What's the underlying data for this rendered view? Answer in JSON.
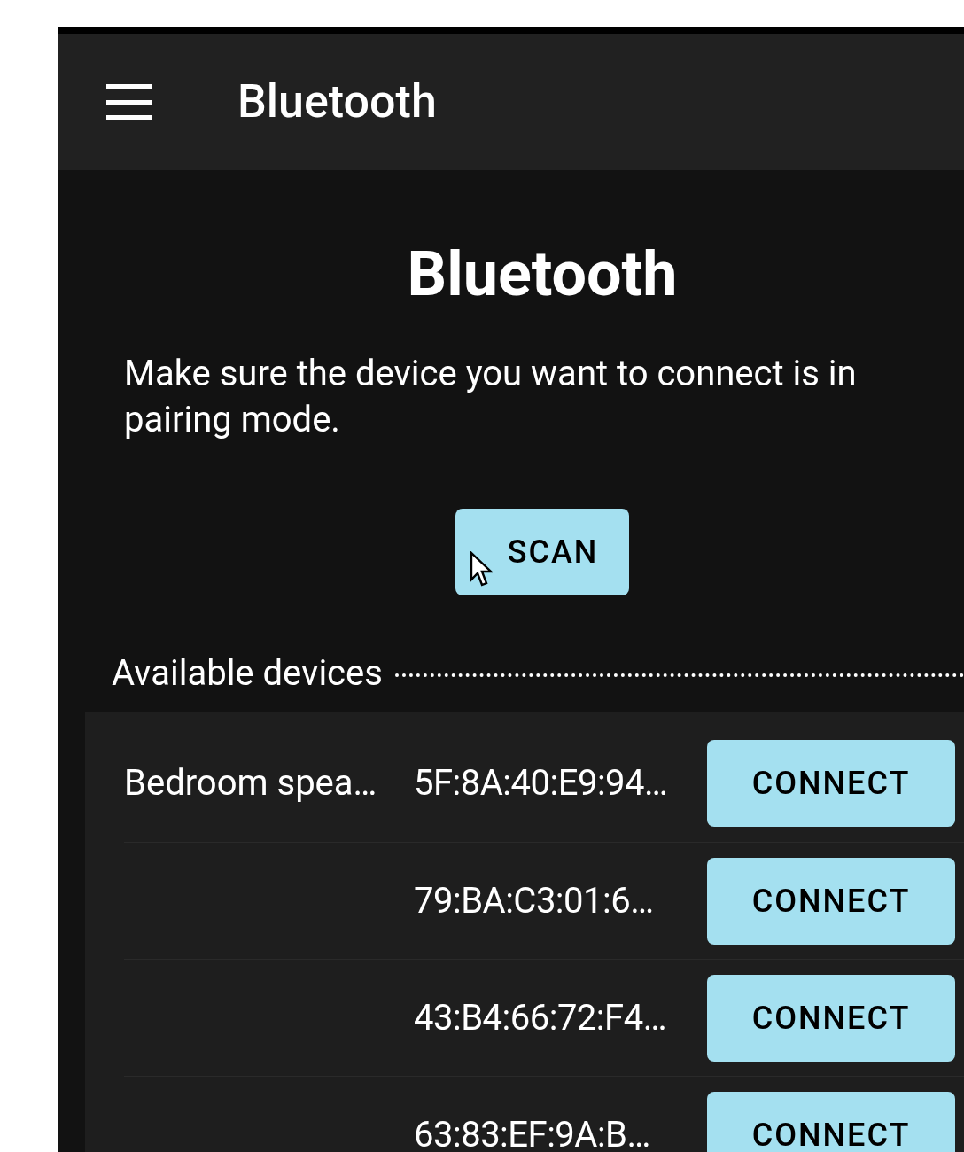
{
  "app_bar": {
    "title": "Bluetooth"
  },
  "heading": "Bluetooth",
  "instructions": "Make sure the device you want to connect is in pairing mode.",
  "scan_button": "SCAN",
  "devices_section": {
    "title": "Available devices",
    "devices": [
      {
        "name": "Bedroom spea…",
        "address": "5F:8A:40:E9:94…",
        "button": "CONNECT"
      },
      {
        "address": "79:BA:C3:01:6…",
        "button": "CONNECT"
      },
      {
        "address": "43:B4:66:72:F4…",
        "button": "CONNECT"
      },
      {
        "address": "63:83:EF:9A:B…",
        "button": "CONNECT"
      }
    ]
  }
}
